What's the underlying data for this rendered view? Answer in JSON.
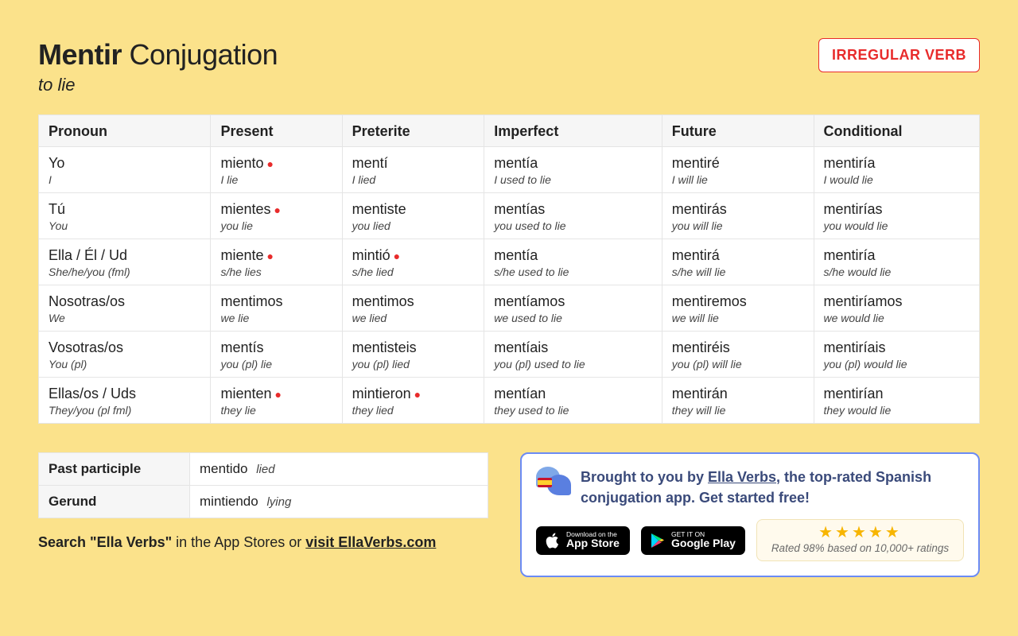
{
  "title": {
    "verb": "Mentir",
    "suffix": " Conjugation",
    "meaning": "to lie"
  },
  "badge": "IRREGULAR VERB",
  "headers": [
    "Pronoun",
    "Present",
    "Preterite",
    "Imperfect",
    "Future",
    "Conditional"
  ],
  "rows": [
    {
      "pronoun": "Yo",
      "pronoun_gloss": "I",
      "cells": [
        {
          "form": "miento",
          "gloss": "I lie",
          "irregular": true
        },
        {
          "form": "mentí",
          "gloss": "I lied",
          "irregular": false
        },
        {
          "form": "mentía",
          "gloss": "I used to lie",
          "irregular": false
        },
        {
          "form": "mentiré",
          "gloss": "I will lie",
          "irregular": false
        },
        {
          "form": "mentiría",
          "gloss": "I would lie",
          "irregular": false
        }
      ]
    },
    {
      "pronoun": "Tú",
      "pronoun_gloss": "You",
      "cells": [
        {
          "form": "mientes",
          "gloss": "you lie",
          "irregular": true
        },
        {
          "form": "mentiste",
          "gloss": "you lied",
          "irregular": false
        },
        {
          "form": "mentías",
          "gloss": "you used to lie",
          "irregular": false
        },
        {
          "form": "mentirás",
          "gloss": "you will lie",
          "irregular": false
        },
        {
          "form": "mentirías",
          "gloss": "you would lie",
          "irregular": false
        }
      ]
    },
    {
      "pronoun": "Ella / Él / Ud",
      "pronoun_gloss": "She/he/you (fml)",
      "cells": [
        {
          "form": "miente",
          "gloss": "s/he lies",
          "irregular": true
        },
        {
          "form": "mintió",
          "gloss": "s/he lied",
          "irregular": true
        },
        {
          "form": "mentía",
          "gloss": "s/he used to lie",
          "irregular": false
        },
        {
          "form": "mentirá",
          "gloss": "s/he will lie",
          "irregular": false
        },
        {
          "form": "mentiría",
          "gloss": "s/he would lie",
          "irregular": false
        }
      ]
    },
    {
      "pronoun": "Nosotras/os",
      "pronoun_gloss": "We",
      "cells": [
        {
          "form": "mentimos",
          "gloss": "we lie",
          "irregular": false
        },
        {
          "form": "mentimos",
          "gloss": "we lied",
          "irregular": false
        },
        {
          "form": "mentíamos",
          "gloss": "we used to lie",
          "irregular": false
        },
        {
          "form": "mentiremos",
          "gloss": "we will lie",
          "irregular": false
        },
        {
          "form": "mentiríamos",
          "gloss": "we would lie",
          "irregular": false
        }
      ]
    },
    {
      "pronoun": "Vosotras/os",
      "pronoun_gloss": "You (pl)",
      "cells": [
        {
          "form": "mentís",
          "gloss": "you (pl) lie",
          "irregular": false
        },
        {
          "form": "mentisteis",
          "gloss": "you (pl) lied",
          "irregular": false
        },
        {
          "form": "mentíais",
          "gloss": "you (pl) used to lie",
          "irregular": false
        },
        {
          "form": "mentiréis",
          "gloss": "you (pl) will lie",
          "irregular": false
        },
        {
          "form": "mentiríais",
          "gloss": "you (pl) would lie",
          "irregular": false
        }
      ]
    },
    {
      "pronoun": "Ellas/os / Uds",
      "pronoun_gloss": "They/you (pl fml)",
      "cells": [
        {
          "form": "mienten",
          "gloss": "they lie",
          "irregular": true
        },
        {
          "form": "mintieron",
          "gloss": "they lied",
          "irregular": true
        },
        {
          "form": "mentían",
          "gloss": "they used to lie",
          "irregular": false
        },
        {
          "form": "mentirán",
          "gloss": "they will lie",
          "irregular": false
        },
        {
          "form": "mentirían",
          "gloss": "they would lie",
          "irregular": false
        }
      ]
    }
  ],
  "participles": {
    "past_label": "Past participle",
    "past_form": "mentido",
    "past_gloss": "lied",
    "gerund_label": "Gerund",
    "gerund_form": "mintiendo",
    "gerund_gloss": "lying"
  },
  "search_line": {
    "bold": "Search \"Ella Verbs\"",
    "rest": " in the App Stores or ",
    "link": "visit EllaVerbs.com"
  },
  "promo": {
    "text_pre": "Brought to you by ",
    "link": "Ella Verbs",
    "text_post": ", the top-rated Spanish conjugation app. Get started free!",
    "appstore_tiny": "Download on the",
    "appstore_big": "App Store",
    "play_tiny": "GET IT ON",
    "play_big": "Google Play",
    "rating_text": "Rated 98% based on 10,000+ ratings"
  }
}
